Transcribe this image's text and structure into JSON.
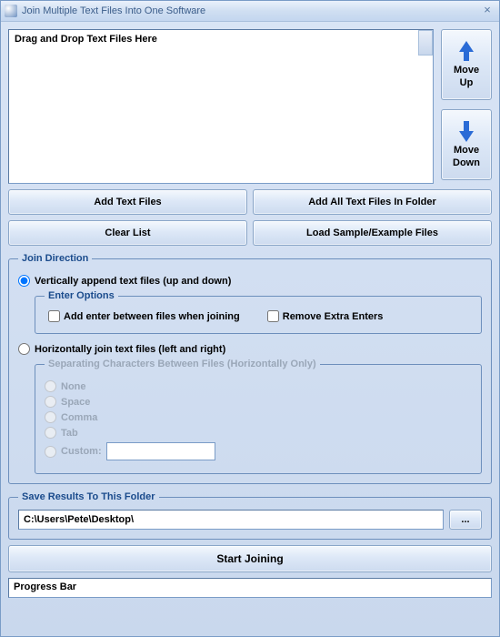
{
  "window": {
    "title": "Join Multiple Text Files Into One Software"
  },
  "filelist": {
    "placeholder": "Drag and Drop Text Files Here"
  },
  "move": {
    "up_line1": "Move",
    "up_line2": "Up",
    "down_line1": "Move",
    "down_line2": "Down"
  },
  "buttons": {
    "add_files": "Add Text Files",
    "add_folder": "Add All Text Files In Folder",
    "clear_list": "Clear List",
    "load_sample": "Load Sample/Example Files",
    "browse": "...",
    "start": "Start Joining"
  },
  "groups": {
    "join_direction": "Join Direction",
    "enter_options": "Enter Options",
    "separating": "Separating Characters Between Files (Horizontally Only)",
    "save_folder": "Save Results To This Folder"
  },
  "options": {
    "vertical": "Vertically append text files (up and down)",
    "add_enter": "Add enter between files when joining",
    "remove_extra": "Remove Extra Enters",
    "horizontal": "Horizontally join text files (left and right)",
    "none": "None",
    "space": "Space",
    "comma": "Comma",
    "tab": "Tab",
    "custom": "Custom:"
  },
  "save": {
    "path": "C:\\Users\\Pete\\Desktop\\"
  },
  "progress": {
    "label": "Progress Bar"
  }
}
